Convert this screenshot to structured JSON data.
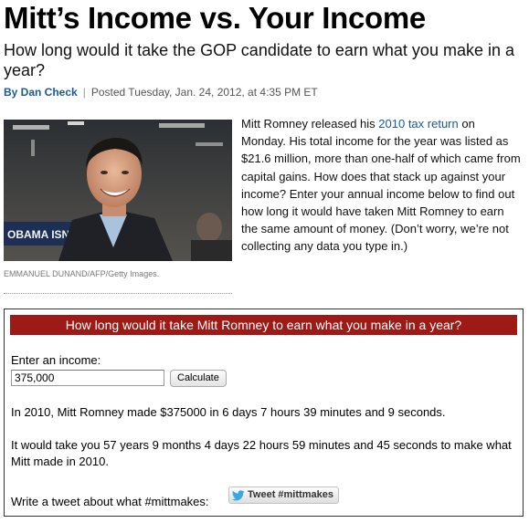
{
  "article": {
    "headline": "Mitt’s Income vs. Your Income",
    "dek": "How long would it take the GOP candidate to earn what you make in a year?",
    "byline": {
      "by": "By Dan Check",
      "posted": "Posted Tuesday, Jan. 24, 2012, at 4:35 PM ET"
    },
    "photo": {
      "sign_text": "OBAMA ISN'T W",
      "credit": "EMMANUEL DUNAND/AFP/Getty Images."
    },
    "body": {
      "before_link": "Mitt Romney released his ",
      "link_text": "2010 tax return",
      "after_link": " on Monday. His total income for the year was listed as $21.6 million, more than one-half of which came from capital gains. How does that stack up against your income? Enter your annual income below to find out how long it would have taken Mitt Romney to earn the same amount of money. (Don’t worry, we’re not collecting any data you type in.)"
    }
  },
  "calculator": {
    "banner": "How long would it take Mitt Romney to earn what you make in a year?",
    "input_label": "Enter an income:",
    "input_value": "375,000",
    "button_label": "Calculate",
    "result_1": "In 2010, Mitt Romney made $375000 in 6 days 7 hours 39 minutes and 9 seconds.",
    "result_2": "It would take you 57 years 9 months 4 days 22 hours 59 minutes and 45 seconds to make what Mitt made in 2010.",
    "tweet_prompt": "Write a tweet about what #mittmakes:",
    "tweet_button_label": "Tweet #mittmakes"
  },
  "colors": {
    "banner_bg": "#9e1a16",
    "link": "#1a5a99"
  },
  "icons": {
    "tweet_button": "twitter-bird-icon"
  }
}
